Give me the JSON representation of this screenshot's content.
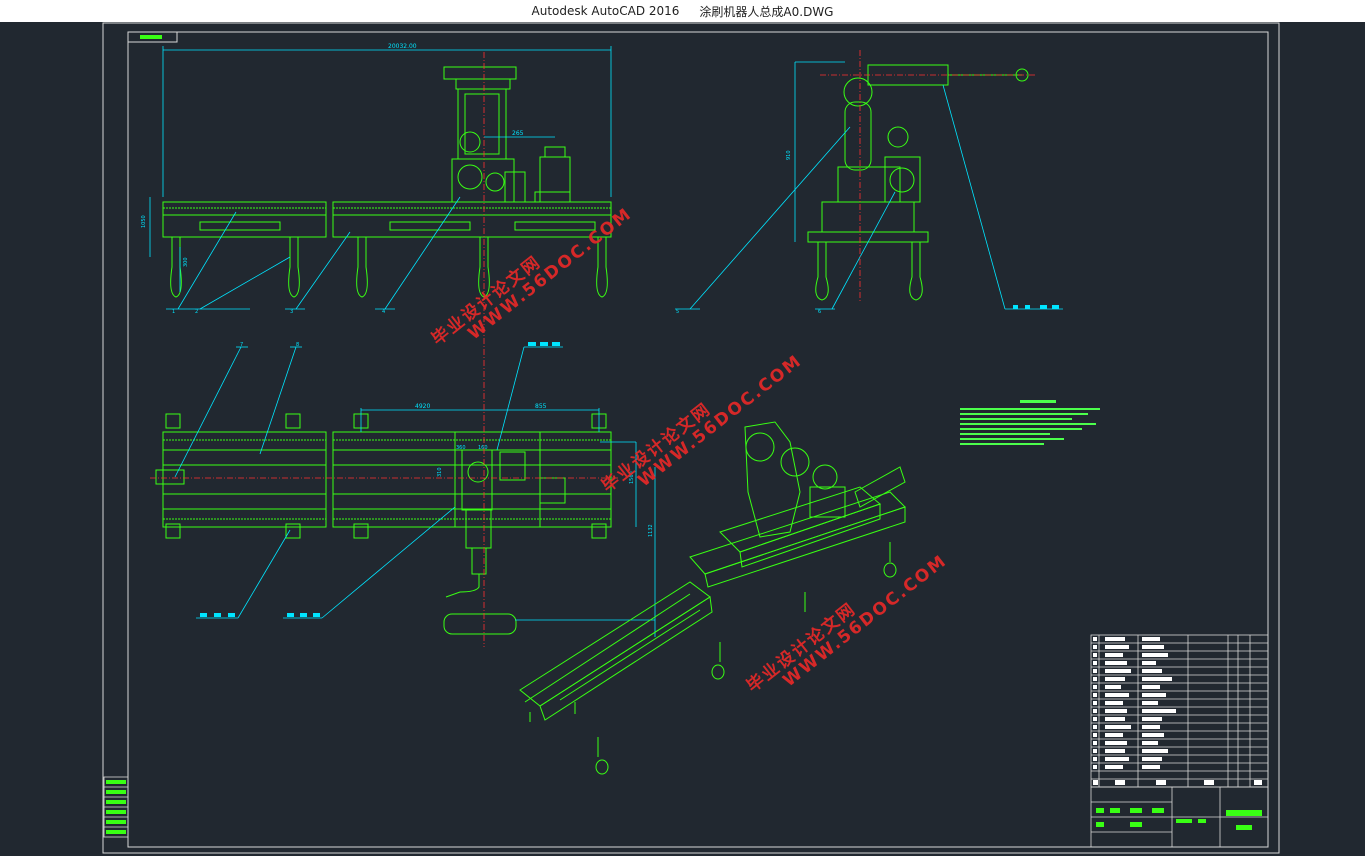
{
  "window": {
    "app_name": "Autodesk AutoCAD 2016",
    "file_name": "涂刷机器人总成A0.DWG"
  },
  "drawing": {
    "dimensions": {
      "overall_length": "20032.00",
      "left_height": "1050",
      "hook_height": "300",
      "offset": "265",
      "side_height": "910",
      "plan_a": "4920",
      "plan_b": "855",
      "plan_h": "1560",
      "plan_c": "360",
      "plan_d": "160",
      "plan_e": "1132",
      "plan_f": "310"
    },
    "part_labels": {
      "front": [
        "1",
        "2",
        "3",
        "4"
      ],
      "side": [
        "5",
        "6"
      ],
      "plan": [
        "7",
        "8"
      ]
    }
  },
  "watermark": {
    "cn": "毕业设计论文网",
    "url": "WWW.56DOC.COM"
  },
  "colors": {
    "background": "#212830",
    "geometry": "#39ff14",
    "dimension": "#00e5ff",
    "centerline": "#ff3030",
    "frame": "#d8d8d8",
    "watermark": "#e62828"
  }
}
